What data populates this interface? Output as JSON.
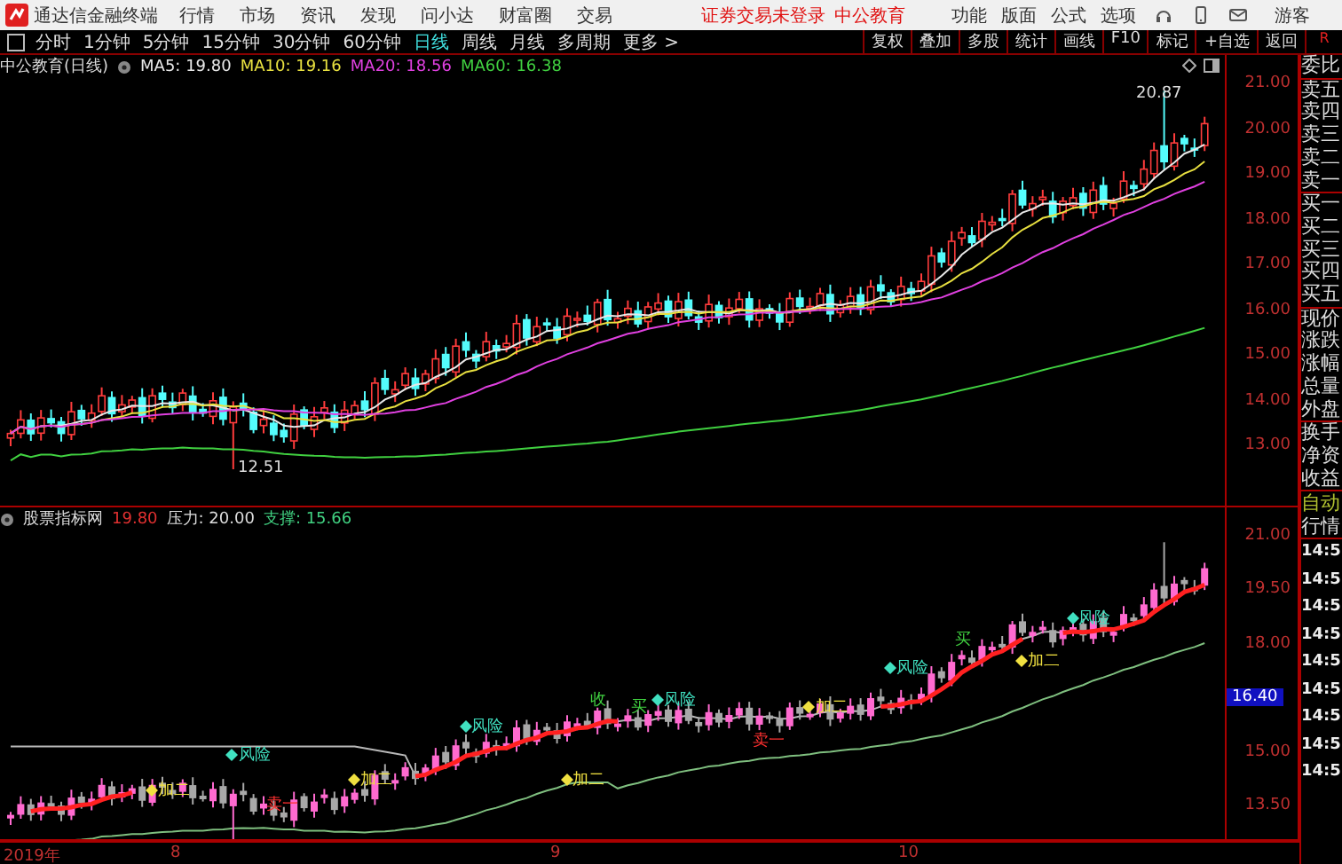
{
  "title_bar": {
    "app_name": "通达信金融终端",
    "menu": [
      "行情",
      "市场",
      "资讯",
      "发现",
      "问小达",
      "财富圈",
      "交易"
    ],
    "login_status": "证券交易未登录",
    "account": "中公教育",
    "functions": [
      "功能",
      "版面",
      "公式",
      "选项"
    ],
    "user": "游客"
  },
  "toolbar": {
    "periods": [
      {
        "label": "分时",
        "selected": false
      },
      {
        "label": "1分钟",
        "selected": false
      },
      {
        "label": "5分钟",
        "selected": false
      },
      {
        "label": "15分钟",
        "selected": false
      },
      {
        "label": "30分钟",
        "selected": false
      },
      {
        "label": "60分钟",
        "selected": false
      },
      {
        "label": "日线",
        "selected": true
      },
      {
        "label": "周线",
        "selected": false
      },
      {
        "label": "月线",
        "selected": false
      },
      {
        "label": "多周期",
        "selected": false
      },
      {
        "label": "更多 >",
        "selected": false
      }
    ],
    "actions": [
      "复权",
      "叠加",
      "多股",
      "统计",
      "画线",
      "F10",
      "标记",
      "+自选",
      "返回"
    ],
    "corner_label": "R"
  },
  "main_chart": {
    "title": "中公教育(日线)",
    "ma_readings": [
      {
        "label": "MA5: 19.80",
        "color": "#e8e8e8"
      },
      {
        "label": "MA10: 19.16",
        "color": "#e8e040"
      },
      {
        "label": "MA20: 18.56",
        "color": "#e040e0"
      },
      {
        "label": "MA60: 16.38",
        "color": "#40d040"
      }
    ],
    "y_ticks": [
      "21.00",
      "20.00",
      "19.00",
      "18.00",
      "17.00",
      "16.00",
      "15.00",
      "14.00",
      "13.00"
    ],
    "annotations": [
      {
        "text": "20.87",
        "kind": "high"
      },
      {
        "text": "12.51",
        "kind": "low"
      }
    ]
  },
  "indicator": {
    "title": "股票指标网",
    "value": "19.80",
    "pressure": "压力: 20.00",
    "support": "支撑: 15.66",
    "y_ticks": [
      {
        "label": "21.00",
        "kind": "tick"
      },
      {
        "label": "19.50",
        "kind": "tick"
      },
      {
        "label": "18.00",
        "kind": "tick"
      },
      {
        "label": "16.40",
        "kind": "current"
      },
      {
        "label": "15.00",
        "kind": "tick"
      },
      {
        "label": "13.50",
        "kind": "tick"
      }
    ],
    "signals": [
      {
        "text": "加二",
        "kind": "add"
      },
      {
        "text": "风险",
        "kind": "risk"
      },
      {
        "text": "卖一",
        "kind": "sell"
      },
      {
        "text": "加二",
        "kind": "add"
      },
      {
        "text": "风险",
        "kind": "risk"
      },
      {
        "text": "加二",
        "kind": "add"
      },
      {
        "text": "收",
        "kind": "close"
      },
      {
        "text": "买",
        "kind": "buy"
      },
      {
        "text": "风险",
        "kind": "risk"
      },
      {
        "text": "卖一",
        "kind": "sell"
      },
      {
        "text": "加二",
        "kind": "add"
      },
      {
        "text": "风险",
        "kind": "risk"
      },
      {
        "text": "买",
        "kind": "buy"
      },
      {
        "text": "加二",
        "kind": "add"
      },
      {
        "text": "风险",
        "kind": "risk"
      }
    ]
  },
  "date_axis": [
    "2019年",
    "8",
    "9",
    "10"
  ],
  "quote_panel": {
    "groups": [
      [
        "委比"
      ],
      [
        "卖五",
        "卖四",
        "卖三",
        "卖二",
        "卖一"
      ],
      [
        "买一",
        "买二",
        "买三",
        "买四",
        "买五"
      ],
      [
        "现价",
        "涨跌",
        "涨幅",
        "总量",
        "外盘"
      ],
      [
        "换手",
        "净资",
        "收益"
      ]
    ],
    "mode": [
      "自动",
      "行情"
    ],
    "times": [
      "14:5",
      "14:5",
      "14:5",
      "14:5",
      "14:5",
      "14:5",
      "14:5",
      "14:5",
      "14:5"
    ]
  }
}
